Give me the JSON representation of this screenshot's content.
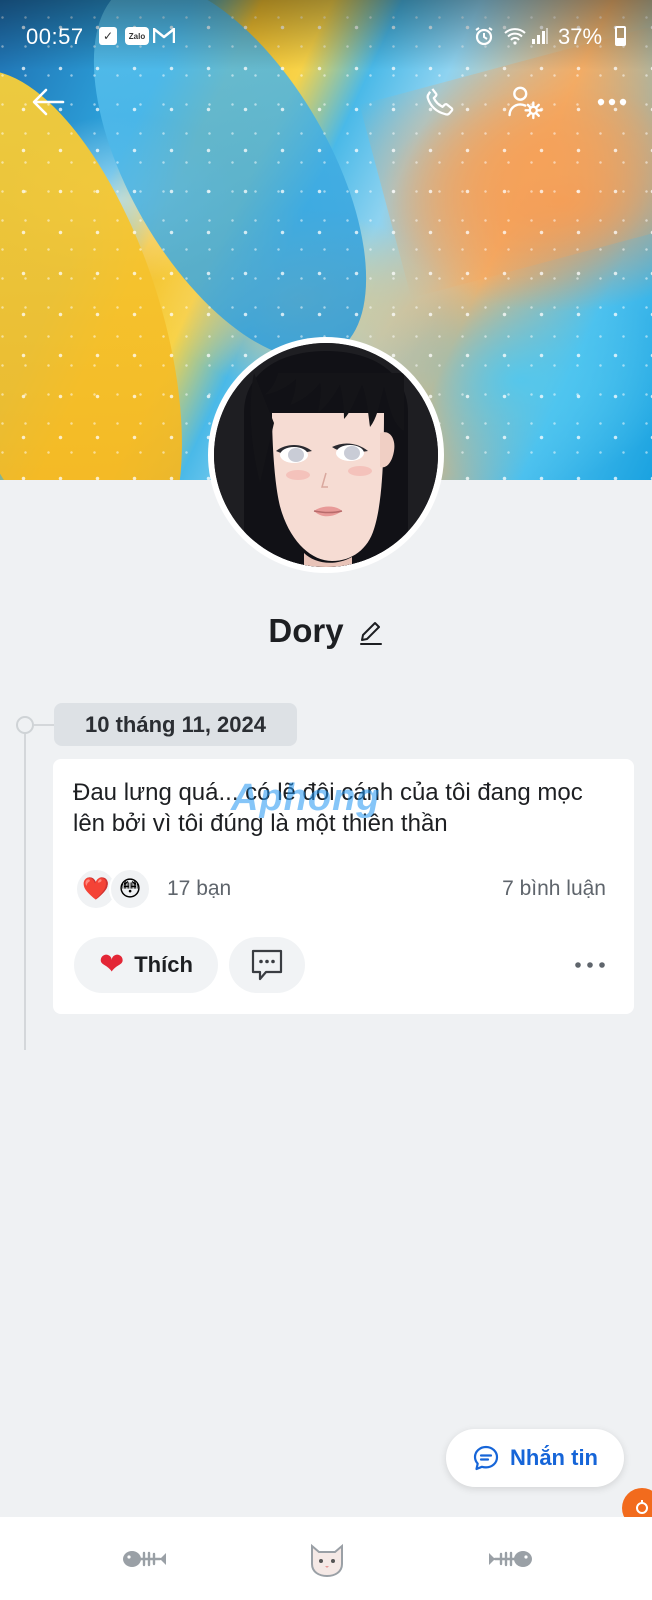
{
  "status_bar": {
    "time": "00:57",
    "battery": "37%",
    "notification_icons": [
      "check-icon",
      "zalo-icon",
      "gmail-icon"
    ],
    "system_icons": [
      "alarm-icon",
      "wifi-icon",
      "signal-icon",
      "battery-icon"
    ],
    "zalo_label": "Zalo"
  },
  "header": {
    "icons": [
      "back-arrow-icon",
      "phone-icon",
      "user-settings-icon",
      "more-icon"
    ]
  },
  "profile": {
    "name": "Dory"
  },
  "timeline": {
    "date": "10 tháng 11, 2024"
  },
  "post": {
    "text": "Đau lưng quá... có lẽ đôi cánh của tôi đang mọc lên bởi vì tôi đúng là một thiên thần",
    "reactions": [
      "❤️",
      "😳"
    ],
    "reaction_count": "17 bạn",
    "comment_count": "7 bình luận",
    "like_label": "Thích",
    "watermark": "Aphong"
  },
  "actions": {
    "message_label": "Nhắn tin"
  },
  "colors": {
    "accent": "#1665d8",
    "heart": "#e32636",
    "background": "#eff1f3",
    "corner_badge": "#f26b1d"
  }
}
